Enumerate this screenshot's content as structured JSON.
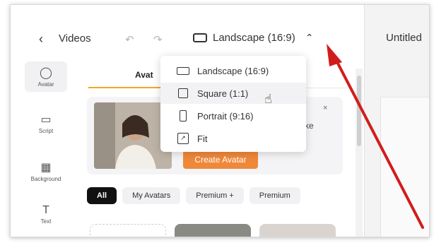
{
  "topbar": {
    "back_label": "Videos",
    "aspect_label": "Landscape (16:9)"
  },
  "right_panel": {
    "title": "Untitled"
  },
  "rail": {
    "items": [
      {
        "label": "Avatar",
        "icon": "person-icon"
      },
      {
        "label": "Script",
        "icon": "chat-bubble-icon"
      },
      {
        "label": "Background",
        "icon": "pattern-icon"
      },
      {
        "label": "Text",
        "icon": "text-icon"
      }
    ]
  },
  "tabs": {
    "avatar_label": "Avat"
  },
  "promo": {
    "text": "ifelike",
    "button_label": "Create Avatar",
    "close": "×"
  },
  "filters": [
    "All",
    "My Avatars",
    "Premium +",
    "Premium"
  ],
  "dropdown": {
    "items": [
      {
        "label": "Landscape (16:9)",
        "icon": "landscape-icon"
      },
      {
        "label": "Square (1:1)",
        "icon": "square-icon",
        "hovered": true
      },
      {
        "label": "Portrait (9:16)",
        "icon": "portrait-icon"
      },
      {
        "label": "Fit",
        "icon": "fit-icon"
      }
    ]
  },
  "colors": {
    "accent_orange": "#f0883a",
    "tab_underline": "#f5a623",
    "annotation_arrow": "#d21c1c"
  }
}
